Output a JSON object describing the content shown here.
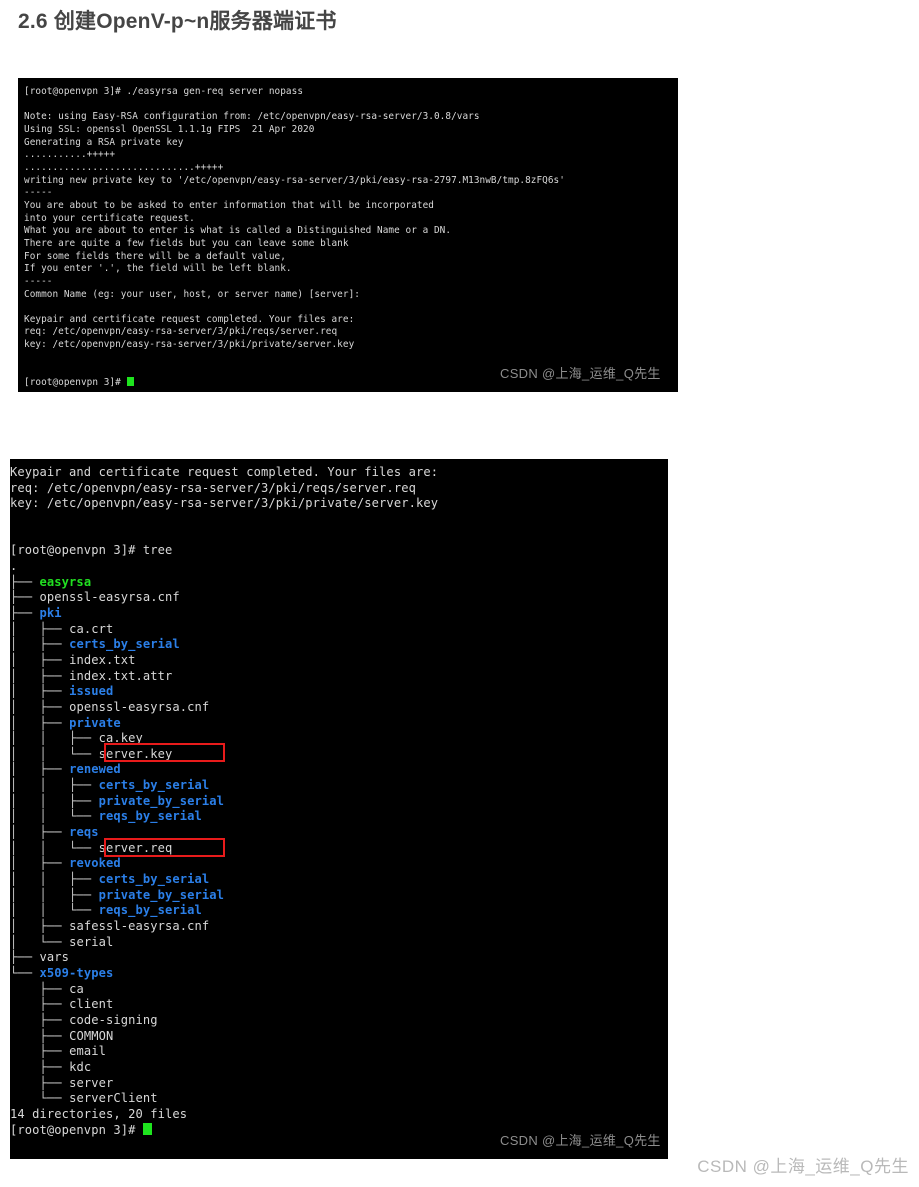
{
  "page": {
    "title": "2.6 创建OpenV-p~n服务器端证书",
    "watermark": "CSDN @上海_运维_Q先生",
    "background_color": "#ffffff",
    "title_color": "#454545"
  },
  "colors": {
    "terminal_background": "#000000",
    "terminal_text": "#d8d8d8",
    "directory": "#2b7fe8",
    "executable": "#21e021",
    "cursor": "#1ee41e",
    "annotation_red": "#e81b1b",
    "watermark": "#8d8d8d"
  },
  "terminal1": {
    "watermark": "CSDN @上海_运维_Q先生",
    "lines": [
      "[root@openvpn 3]# ./easyrsa gen-req server nopass",
      "",
      "Note: using Easy-RSA configuration from: /etc/openvpn/easy-rsa-server/3.0.8/vars",
      "Using SSL: openssl OpenSSL 1.1.1g FIPS  21 Apr 2020",
      "Generating a RSA private key",
      "...........+++++",
      "..............................+++++",
      "writing new private key to '/etc/openvpn/easy-rsa-server/3/pki/easy-rsa-2797.M13nwB/tmp.8zFQ6s'",
      "-----",
      "You are about to be asked to enter information that will be incorporated",
      "into your certificate request.",
      "What you are about to enter is what is called a Distinguished Name or a DN.",
      "There are quite a few fields but you can leave some blank",
      "For some fields there will be a default value,",
      "If you enter '.', the field will be left blank.",
      "-----",
      "Common Name (eg: your user, host, or server name) [server]:",
      "",
      "Keypair and certificate request completed. Your files are:",
      "req: /etc/openvpn/easy-rsa-server/3/pki/reqs/server.req",
      "key: /etc/openvpn/easy-rsa-server/3/pki/private/server.key",
      "",
      ""
    ],
    "prompt": "[root@openvpn 3]# "
  },
  "terminal2": {
    "watermark": "CSDN @上海_运维_Q先生",
    "header_lines": [
      "Keypair and certificate request completed. Your files are:",
      "req: /etc/openvpn/easy-rsa-server/3/pki/reqs/server.req",
      "key: /etc/openvpn/easy-rsa-server/3/pki/private/server.key",
      "",
      ""
    ],
    "command_prompt": "[root@openvpn 3]# ",
    "command": "tree",
    "tree_root": ".",
    "tree": [
      {
        "branch": "├── ",
        "name": "easyrsa",
        "kind": "exec"
      },
      {
        "branch": "├── ",
        "name": "openssl-easyrsa.cnf",
        "kind": "file"
      },
      {
        "branch": "├── ",
        "name": "pki",
        "kind": "dir"
      },
      {
        "branch": "│   ├── ",
        "name": "ca.crt",
        "kind": "file"
      },
      {
        "branch": "│   ├── ",
        "name": "certs_by_serial",
        "kind": "dir"
      },
      {
        "branch": "│   ├── ",
        "name": "index.txt",
        "kind": "file"
      },
      {
        "branch": "│   ├── ",
        "name": "index.txt.attr",
        "kind": "file"
      },
      {
        "branch": "│   ├── ",
        "name": "issued",
        "kind": "dir"
      },
      {
        "branch": "│   ├── ",
        "name": "openssl-easyrsa.cnf",
        "kind": "file"
      },
      {
        "branch": "│   ├── ",
        "name": "private",
        "kind": "dir"
      },
      {
        "branch": "│   │   ├── ",
        "name": "ca.key",
        "kind": "file"
      },
      {
        "branch": "│   │   └── ",
        "name": "server.key",
        "kind": "file",
        "highlighted": true
      },
      {
        "branch": "│   ├── ",
        "name": "renewed",
        "kind": "dir"
      },
      {
        "branch": "│   │   ├── ",
        "name": "certs_by_serial",
        "kind": "dir"
      },
      {
        "branch": "│   │   ├── ",
        "name": "private_by_serial",
        "kind": "dir"
      },
      {
        "branch": "│   │   └── ",
        "name": "reqs_by_serial",
        "kind": "dir"
      },
      {
        "branch": "│   ├── ",
        "name": "reqs",
        "kind": "dir"
      },
      {
        "branch": "│   │   └── ",
        "name": "server.req",
        "kind": "file",
        "highlighted": true
      },
      {
        "branch": "│   ├── ",
        "name": "revoked",
        "kind": "dir"
      },
      {
        "branch": "│   │   ├── ",
        "name": "certs_by_serial",
        "kind": "dir"
      },
      {
        "branch": "│   │   ├── ",
        "name": "private_by_serial",
        "kind": "dir"
      },
      {
        "branch": "│   │   └── ",
        "name": "reqs_by_serial",
        "kind": "dir"
      },
      {
        "branch": "│   ├── ",
        "name": "safessl-easyrsa.cnf",
        "kind": "file"
      },
      {
        "branch": "│   └── ",
        "name": "serial",
        "kind": "file"
      },
      {
        "branch": "├── ",
        "name": "vars",
        "kind": "file"
      },
      {
        "branch": "└── ",
        "name": "x509-types",
        "kind": "dir"
      },
      {
        "branch": "    ├── ",
        "name": "ca",
        "kind": "file"
      },
      {
        "branch": "    ├── ",
        "name": "client",
        "kind": "file"
      },
      {
        "branch": "    ├── ",
        "name": "code-signing",
        "kind": "file"
      },
      {
        "branch": "    ├── ",
        "name": "COMMON",
        "kind": "file"
      },
      {
        "branch": "    ├── ",
        "name": "email",
        "kind": "file"
      },
      {
        "branch": "    ├── ",
        "name": "kdc",
        "kind": "file"
      },
      {
        "branch": "    ├── ",
        "name": "server",
        "kind": "file"
      },
      {
        "branch": "    └── ",
        "name": "serverClient",
        "kind": "file"
      }
    ],
    "summary": "14 directories, 20 files",
    "final_prompt": "[root@openvpn 3]# "
  }
}
